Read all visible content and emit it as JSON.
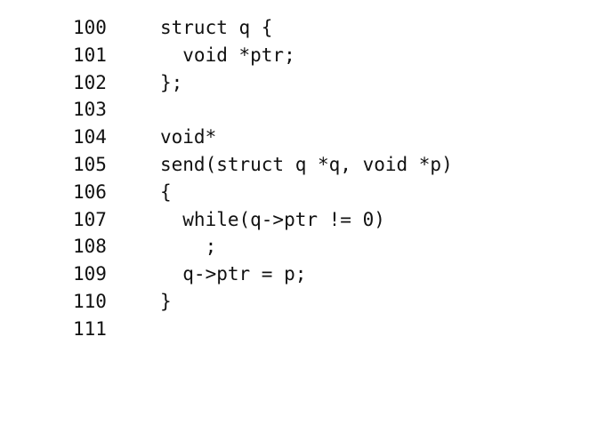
{
  "listing": {
    "lines": [
      {
        "number": "100",
        "code": "struct q {"
      },
      {
        "number": "101",
        "code": "  void *ptr;"
      },
      {
        "number": "102",
        "code": "};"
      },
      {
        "number": "103",
        "code": ""
      },
      {
        "number": "104",
        "code": "void*"
      },
      {
        "number": "105",
        "code": "send(struct q *q, void *p)"
      },
      {
        "number": "106",
        "code": "{"
      },
      {
        "number": "107",
        "code": "  while(q->ptr != 0)"
      },
      {
        "number": "108",
        "code": "    ;"
      },
      {
        "number": "109",
        "code": "  q->ptr = p;"
      },
      {
        "number": "110",
        "code": "}"
      },
      {
        "number": "111",
        "code": ""
      }
    ]
  }
}
